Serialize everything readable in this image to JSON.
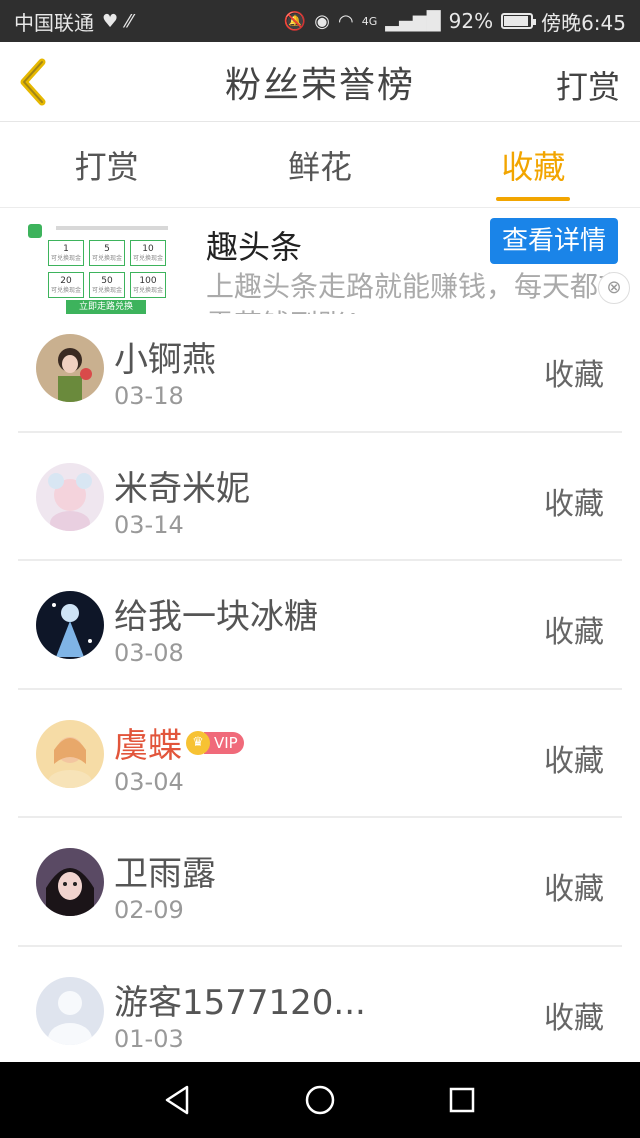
{
  "status_bar": {
    "carrier": "中国联通",
    "battery": "92%",
    "battery_level": 0.92,
    "time": "傍晚6:45",
    "network": "4G"
  },
  "header": {
    "title": "粉丝荣誉榜",
    "right_label": "打赏"
  },
  "tabs": [
    {
      "label": "打赏",
      "active": false
    },
    {
      "label": "鲜花",
      "active": false
    },
    {
      "label": "收藏",
      "active": true
    }
  ],
  "ad": {
    "title": "趣头条",
    "description": "上趣头条走路就能赚钱，每天都有零花钱到账！",
    "cta": "查看详情",
    "thumb_values": [
      "1",
      "5",
      "10",
      "20",
      "50",
      "100"
    ],
    "thumb_cell_caption": "可兑换现金",
    "thumb_button": "立即走路兑换"
  },
  "list": [
    {
      "name": "小锕燕",
      "date": "03-18",
      "action": "收藏",
      "vip": false
    },
    {
      "name": "米奇米妮",
      "date": "03-14",
      "action": "收藏",
      "vip": false
    },
    {
      "name": "给我一块冰糖",
      "date": "03-08",
      "action": "收藏",
      "vip": false
    },
    {
      "name": "虞蝶",
      "date": "03-04",
      "action": "收藏",
      "vip": true,
      "vip_label": "VIP"
    },
    {
      "name": "卫雨露",
      "date": "02-09",
      "action": "收藏",
      "vip": false
    },
    {
      "name": "游客1577120...",
      "date": "01-03",
      "action": "收藏",
      "vip": false
    }
  ],
  "colors": {
    "accent": "#f2a500",
    "cta_blue": "#1a84e8",
    "vip_name": "#e2553b",
    "status_bar": "#2f2f2f"
  }
}
